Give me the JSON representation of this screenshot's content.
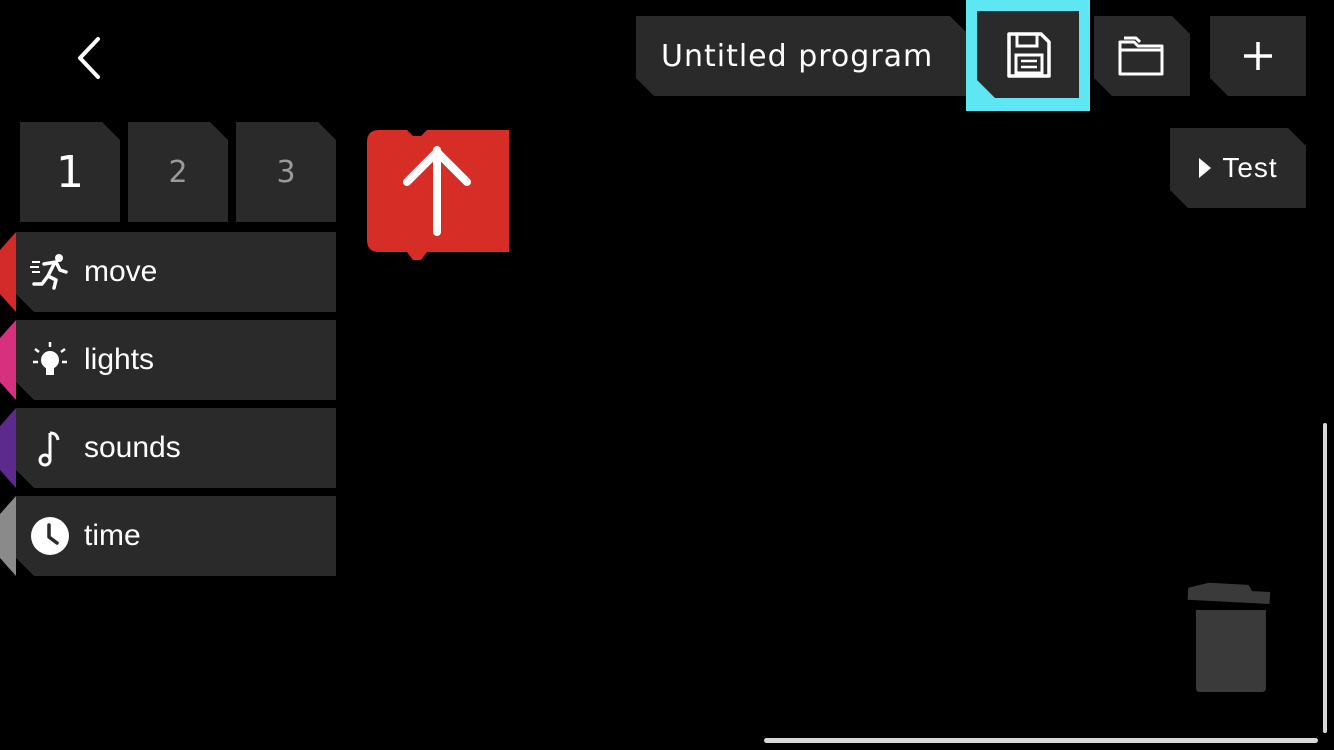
{
  "header": {
    "program_title": "Untitled program",
    "back_icon": "chevron-left-icon",
    "save_icon": "floppy-disk-icon",
    "folder_icon": "folder-icon",
    "add_icon": "plus-icon",
    "highlight_color": "#5ee6f2"
  },
  "tabs": [
    {
      "label": "1",
      "active": true
    },
    {
      "label": "2",
      "active": false
    },
    {
      "label": "3",
      "active": false
    }
  ],
  "categories": [
    {
      "label": "move",
      "icon": "running-person-icon",
      "color": "#d32a2a"
    },
    {
      "label": "lights",
      "icon": "lightbulb-icon",
      "color": "#d6307f"
    },
    {
      "label": "sounds",
      "icon": "music-note-icon",
      "color": "#5b2a8c"
    },
    {
      "label": "time",
      "icon": "clock-icon",
      "color": "#8a8a8a"
    }
  ],
  "canvas": {
    "block": {
      "icon": "up-arrow-icon",
      "color": "#d62d27"
    },
    "test_label": "Test",
    "test_icon": "play-triangle-icon",
    "trash_icon": "trash-can-icon"
  }
}
